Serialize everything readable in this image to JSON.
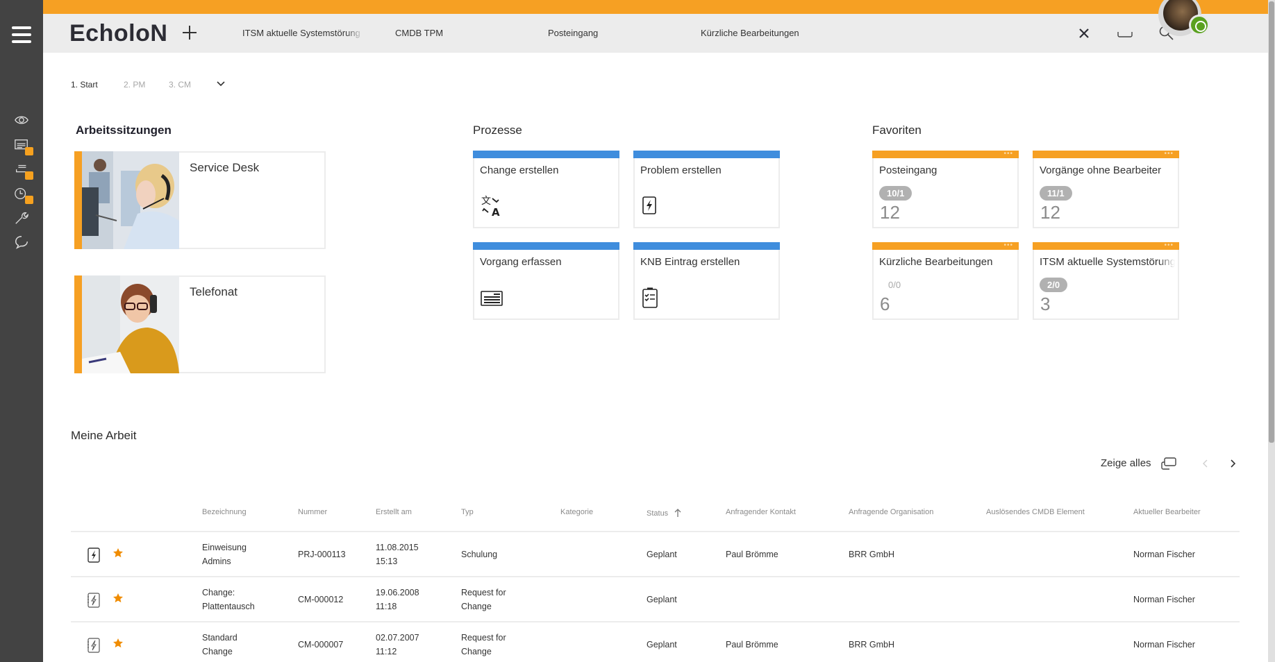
{
  "app": {
    "title": "EcholoN",
    "accent_orange": "#f6a023",
    "accent_blue": "#3f8ddd",
    "rail_color": "#434343"
  },
  "rail": {
    "items": [
      {
        "icon": "eye-icon",
        "badge": false
      },
      {
        "icon": "list-board-icon",
        "badge": true
      },
      {
        "icon": "stack-icon",
        "badge": true
      },
      {
        "icon": "clock-icon",
        "badge": true
      },
      {
        "icon": "wrench-icon",
        "badge": false
      },
      {
        "icon": "chat-icon",
        "badge": false
      }
    ]
  },
  "topbar": {
    "tabs": [
      {
        "label": "ITSM aktuelle Systemstörung"
      },
      {
        "label": "CMDB TPM"
      },
      {
        "label": "Posteingang"
      },
      {
        "label": "Kürzliche Bearbeitungen"
      }
    ],
    "icons": [
      "close-icon",
      "workspace-icon",
      "search-icon"
    ],
    "user_status_color": "#5aa11f"
  },
  "breadcrumb": {
    "items": [
      {
        "label": "1. Start",
        "active": true
      },
      {
        "label": "2. PM",
        "active": false
      },
      {
        "label": "3. CM",
        "active": false
      }
    ]
  },
  "sessions": {
    "title": "Arbeitssitzungen",
    "items": [
      {
        "label": "Service Desk"
      },
      {
        "label": "Telefonat"
      }
    ]
  },
  "processes": {
    "title": "Prozesse",
    "items": [
      {
        "label": "Change erstellen",
        "icon": "translate-icon"
      },
      {
        "label": "Problem erstellen",
        "icon": "lightning-icon"
      },
      {
        "label": "Vorgang erfassen",
        "icon": "form-icon"
      },
      {
        "label": "KNB Eintrag erstellen",
        "icon": "clipboard-checklist-icon"
      }
    ]
  },
  "favorites": {
    "title": "Favoriten",
    "items": [
      {
        "label": "Posteingang",
        "ratio": "10/1",
        "count": "12",
        "highlight": true
      },
      {
        "label": "Vorgänge ohne Bearbeiter",
        "ratio": "11/1",
        "count": "12",
        "highlight": true
      },
      {
        "label": "Kürzliche Bearbeitungen",
        "ratio": "0/0",
        "count": "6",
        "highlight": false
      },
      {
        "label": "ITSM aktuelle Systemstörungen",
        "ratio": "2/0",
        "count": "3",
        "highlight": true
      }
    ]
  },
  "work": {
    "title": "Meine Arbeit",
    "show_all": "Zeige alles",
    "columns": [
      "Bezeichnung",
      "Nummer",
      "Erstellt am",
      "Typ",
      "Kategorie",
      "Status",
      "Anfragender Kontakt",
      "Anfragende Organisation",
      "Auslösendes CMDB Element",
      "Aktueller Bearbeiter"
    ],
    "sort_column": "Status",
    "rows": [
      {
        "icon": "lightning-icon",
        "starred": true,
        "name": [
          "Einweisung",
          "Admins"
        ],
        "number": "PRJ-000113",
        "created": [
          "11.08.2015",
          "15:13"
        ],
        "type": [
          "Schulung"
        ],
        "category": "",
        "status": "Geplant",
        "contact": "Paul Brömme",
        "organisation": "BRR GmbH",
        "cmdb": "",
        "assignee": "Norman Fischer"
      },
      {
        "icon": "change-icon",
        "starred": true,
        "name": [
          "Change:",
          "Plattentausch"
        ],
        "number": "CM-000012",
        "created": [
          "19.06.2008",
          "11:18"
        ],
        "type": [
          "Request for",
          "Change"
        ],
        "category": "",
        "status": "Geplant",
        "contact": "",
        "organisation": "",
        "cmdb": "",
        "assignee": "Norman Fischer"
      },
      {
        "icon": "change-icon",
        "starred": true,
        "name": [
          "Standard",
          "Change"
        ],
        "number": "CM-000007",
        "created": [
          "02.07.2007",
          "11:12"
        ],
        "type": [
          "Request for",
          "Change"
        ],
        "category": "",
        "status": "Geplant",
        "contact": "Paul Brömme",
        "organisation": "BRR GmbH",
        "cmdb": "",
        "assignee": "Norman Fischer"
      }
    ]
  }
}
